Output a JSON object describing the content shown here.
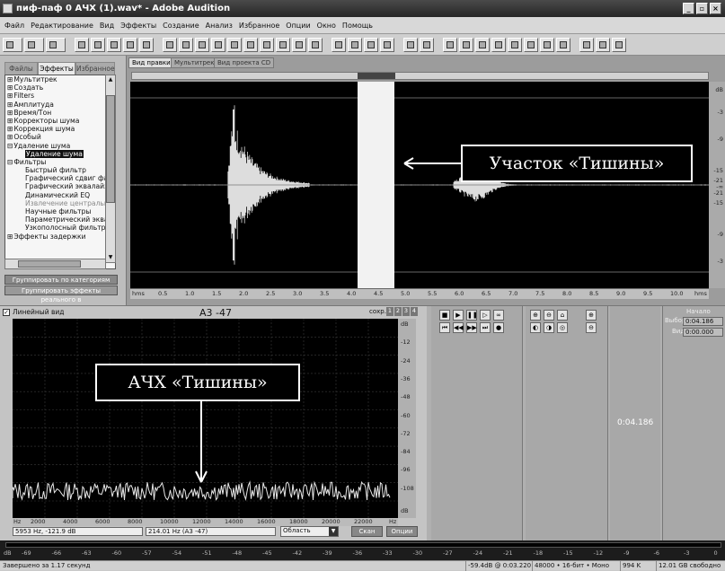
{
  "window": {
    "title": "пиф-паф 0 АЧХ (1).wav* - Adobe Audition"
  },
  "menu": [
    "Файл",
    "Редактирование",
    "Вид",
    "Эффекты",
    "Создание",
    "Анализ",
    "Избранное",
    "Опции",
    "Окно",
    "Помощь"
  ],
  "left_panel": {
    "tabs": [
      "Файлы",
      "Эффекты",
      "Избранное"
    ],
    "active_tab": "Эффекты",
    "tree": [
      {
        "label": "Мультитрек",
        "level": 0,
        "expand": "+"
      },
      {
        "label": "Создать",
        "level": 0,
        "expand": "+"
      },
      {
        "label": "Filters",
        "level": 0,
        "expand": "+"
      },
      {
        "label": "Амплитуда",
        "level": 0,
        "expand": "+"
      },
      {
        "label": "Время/Тон",
        "level": 0,
        "expand": "+"
      },
      {
        "label": "Корректоры шума",
        "level": 0,
        "expand": "+"
      },
      {
        "label": "Коррекция шума",
        "level": 0,
        "expand": "+"
      },
      {
        "label": "Особый",
        "level": 0,
        "expand": "+"
      },
      {
        "label": "Удаление шума",
        "level": 0,
        "expand": "-"
      },
      {
        "label": "Удаление шума",
        "level": 1,
        "selected": true
      },
      {
        "label": "Фильтры",
        "level": 0,
        "expand": "-"
      },
      {
        "label": "Быстрый фильтр",
        "level": 1
      },
      {
        "label": "Графический сдвиг фаз",
        "level": 1
      },
      {
        "label": "Графический эквалайзе",
        "level": 1
      },
      {
        "label": "Динамический EQ",
        "level": 1
      },
      {
        "label": "Извлечение центрально",
        "level": 1,
        "gray": true
      },
      {
        "label": "Научные фильтры",
        "level": 1
      },
      {
        "label": "Параметрический эквал",
        "level": 1
      },
      {
        "label": "Узкополосный фильтр",
        "level": 1
      },
      {
        "label": "Эффекты задержки",
        "level": 0,
        "expand": "+"
      }
    ],
    "group_button": "Группировать по категориям",
    "realtime_button": "Группировать эффекты реального в"
  },
  "view_tabs": [
    "Вид правки",
    "Мультитрек",
    "Вид проекта CD"
  ],
  "callouts": {
    "silence_region": "Участок «Тишины»",
    "silence_afr": "АЧХ «Тишины»"
  },
  "db_scale": [
    "dB",
    "-3",
    "-9",
    "-15",
    "-21",
    "-∞",
    "-21",
    "-15",
    "-9",
    "-3"
  ],
  "time_ruler": [
    "hms",
    "0.5",
    "1.0",
    "1.5",
    "2.0",
    "2.5",
    "3.0",
    "3.5",
    "4.0",
    "4.5",
    "5.0",
    "5.5",
    "6.0",
    "6.5",
    "7.0",
    "7.5",
    "8.0",
    "8.5",
    "9.0",
    "9.5",
    "10.0",
    "hms"
  ],
  "analysis": {
    "linear_view_label": "Линейный вид",
    "note": "A3 -47",
    "save_label": "сохр.",
    "slots": [
      "1",
      "2",
      "3",
      "4"
    ],
    "hz_ticks": [
      "Hz",
      "2000",
      "4000",
      "6000",
      "8000",
      "10000",
      "12000",
      "14000",
      "16000",
      "18000",
      "20000",
      "22000",
      "Hz"
    ],
    "db_ticks": [
      "dB",
      "-12",
      "-24",
      "-36",
      "-48",
      "-60",
      "-72",
      "-84",
      "-96",
      "-108",
      "dB"
    ],
    "cursor_readout": "5953 Hz, -121.9 dB",
    "freq_readout": "214.01 Hz (A3 -47)",
    "area_select": "Область",
    "scan_button": "Скан",
    "options_button": "Опции"
  },
  "transport": {
    "time_display": "0:04.186",
    "start_label": "Начало",
    "sel_label": "Выбор",
    "view_label": "Вид",
    "sel_value": "0:04.186",
    "view_value": "0:00.000"
  },
  "meter_ticks": [
    "dB",
    "-69",
    "-66",
    "-63",
    "-60",
    "-57",
    "-54",
    "-51",
    "-48",
    "-45",
    "-42",
    "-39",
    "-36",
    "-33",
    "-30",
    "-27",
    "-24",
    "-21",
    "-18",
    "-15",
    "-12",
    "-9",
    "-6",
    "-3",
    "0"
  ],
  "status": {
    "left": "Завершено за 1.17 секунд",
    "level": "-59.4dB @ 0:03.220",
    "format": "48000 • 16-бит • Моно",
    "size": "994 K",
    "free": "12.01 GB свободно"
  }
}
